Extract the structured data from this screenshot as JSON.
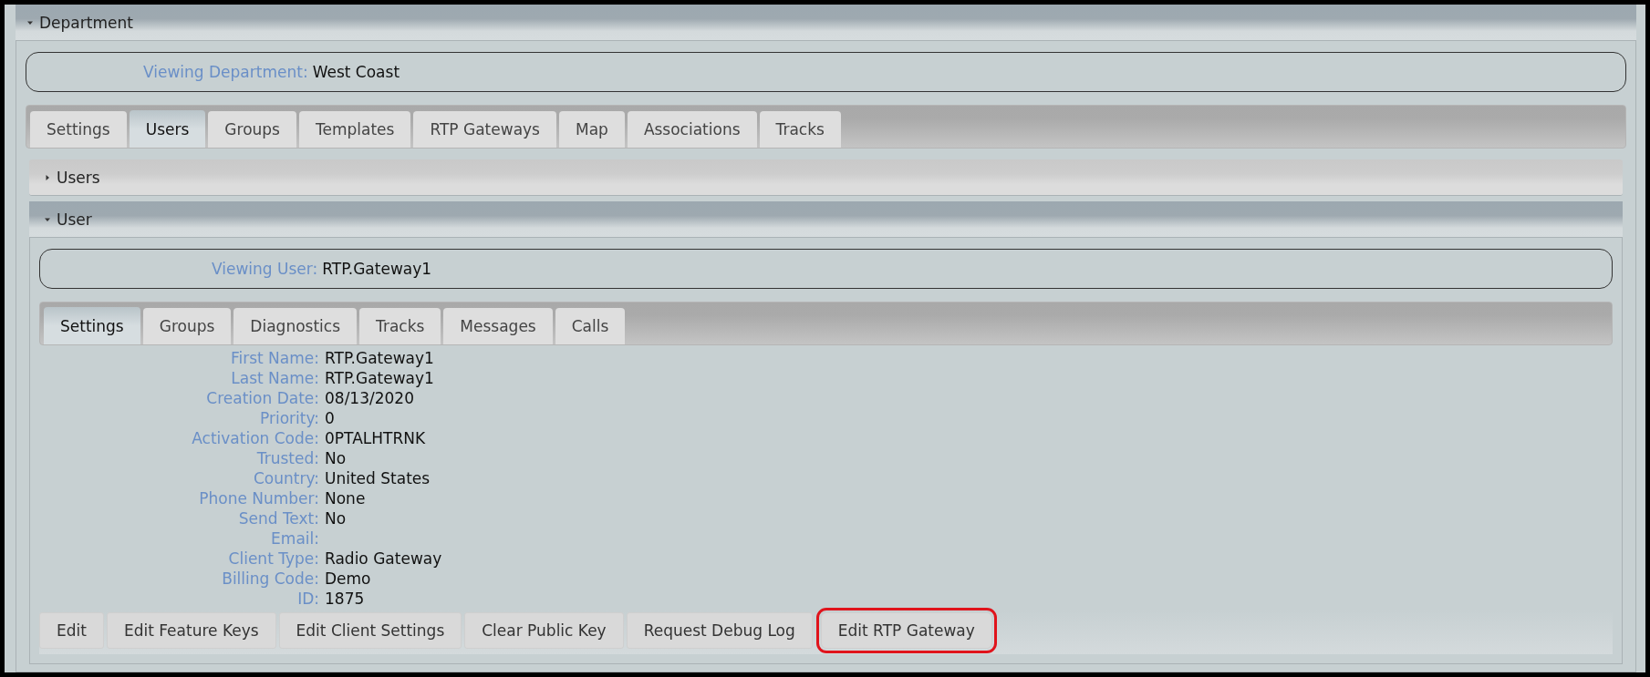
{
  "department": {
    "title": "Department",
    "expanded": true,
    "viewing_label": "Viewing Department:",
    "viewing_value": "West Coast",
    "tabs": [
      {
        "label": "Settings",
        "selected": false
      },
      {
        "label": "Users",
        "selected": true
      },
      {
        "label": "Groups",
        "selected": false
      },
      {
        "label": "Templates",
        "selected": false
      },
      {
        "label": "RTP Gateways",
        "selected": false
      },
      {
        "label": "Map",
        "selected": false
      },
      {
        "label": "Associations",
        "selected": false
      },
      {
        "label": "Tracks",
        "selected": false
      }
    ],
    "sections": [
      {
        "title": "Users",
        "expanded": false
      },
      {
        "title": "User",
        "expanded": true
      }
    ]
  },
  "user": {
    "viewing_label": "Viewing User:",
    "viewing_value": "RTP.Gateway1",
    "tabs": [
      {
        "label": "Settings",
        "selected": true
      },
      {
        "label": "Groups",
        "selected": false
      },
      {
        "label": "Diagnostics",
        "selected": false
      },
      {
        "label": "Tracks",
        "selected": false
      },
      {
        "label": "Messages",
        "selected": false
      },
      {
        "label": "Calls",
        "selected": false
      }
    ],
    "fields": [
      {
        "label": "First Name:",
        "value": "RTP.Gateway1"
      },
      {
        "label": "Last Name:",
        "value": "RTP.Gateway1"
      },
      {
        "label": "Creation Date:",
        "value": "08/13/2020"
      },
      {
        "label": "Priority:",
        "value": "0"
      },
      {
        "label": "Activation Code:",
        "value": "0PTALHTRNK"
      },
      {
        "label": "Trusted:",
        "value": "No"
      },
      {
        "label": "Country:",
        "value": "United States"
      },
      {
        "label": "Phone Number:",
        "value": "None"
      },
      {
        "label": "Send Text:",
        "value": "No"
      },
      {
        "label": "Email:"
      },
      {
        "label": "Client Type:",
        "value": "Radio Gateway"
      },
      {
        "label": "Billing Code:",
        "value": "Demo"
      },
      {
        "label": "ID:",
        "value": "1875"
      }
    ],
    "buttons": [
      {
        "label": "Edit",
        "highlighted": false
      },
      {
        "label": "Edit Feature Keys",
        "highlighted": false
      },
      {
        "label": "Edit Client Settings",
        "highlighted": false
      },
      {
        "label": "Clear Public Key",
        "highlighted": false
      },
      {
        "label": "Request Debug Log",
        "highlighted": false
      },
      {
        "label": "Edit RTP Gateway",
        "highlighted": true
      }
    ]
  }
}
